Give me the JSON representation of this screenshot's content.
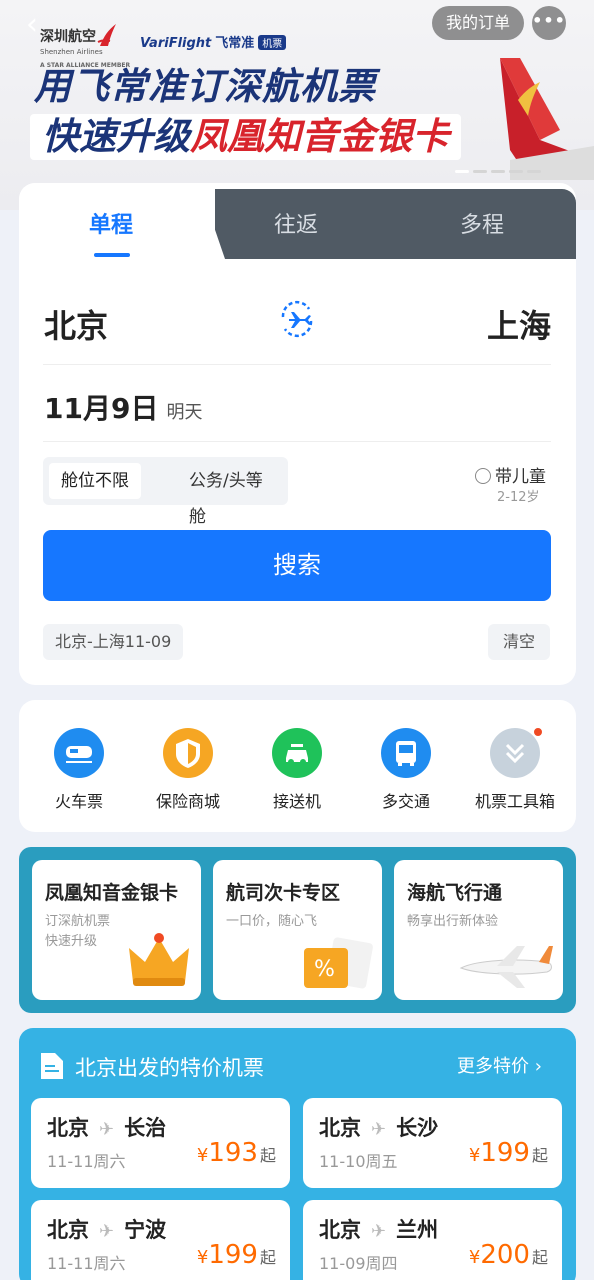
{
  "top": {
    "back_glyph": "‹",
    "orders_label": "我的订单",
    "more_glyph": "•••",
    "brand_cn": "深圳航空",
    "brand_en": "Shenzhen Airlines",
    "alliance": "A STAR ALLIANCE MEMBER",
    "variflight": "VariFlight",
    "variflight_cn": "飞常准",
    "variflight_tag": "机票"
  },
  "banner": {
    "line1": "用飞常准订深航机票",
    "line2_a": "快速升级",
    "line2_b": "凤凰知音金银卡"
  },
  "booking": {
    "tabs": [
      "单程",
      "往返",
      "多程"
    ],
    "from_city": "北京",
    "to_city": "上海",
    "date": "11月9日",
    "date_rel": "明天",
    "cabin_options": [
      "舱位不限",
      "公务/头等舱"
    ],
    "child_label": "带儿童",
    "child_age": "2-12岁",
    "search_label": "搜索",
    "history_item": "北京-上海11-09",
    "clear_label": "清空"
  },
  "services": [
    {
      "label": "火车票",
      "icon": "train-icon",
      "color": "#1f8cf0"
    },
    {
      "label": "保险商城",
      "icon": "shield-icon",
      "color": "#f6a623"
    },
    {
      "label": "接送机",
      "icon": "car-icon",
      "color": "#1fc25a"
    },
    {
      "label": "多交通",
      "icon": "bus-icon",
      "color": "#1f8cf0"
    },
    {
      "label": "机票工具箱",
      "icon": "chevron-double-down-icon",
      "color": "#c7d2dc"
    }
  ],
  "promos": [
    {
      "title": "凤凰知音金银卡",
      "sub1": "订深航机票",
      "sub2": "快速升级"
    },
    {
      "title": "航司次卡专区",
      "sub1": "一口价，随心飞",
      "sub2": ""
    },
    {
      "title": "海航飞行通",
      "sub1": "畅享出行新体验",
      "sub2": ""
    }
  ],
  "deals": {
    "title": "北京出发的特价机票",
    "more": "更多特价",
    "more_arrow": "›",
    "plane_glyph": "✈",
    "currency": "¥",
    "suffix": "起",
    "items": [
      {
        "from": "北京",
        "to": "长治",
        "date": "11-11周六",
        "price": "193"
      },
      {
        "from": "北京",
        "to": "长沙",
        "date": "11-10周五",
        "price": "199"
      },
      {
        "from": "北京",
        "to": "宁波",
        "date": "11-11周六",
        "price": "199"
      },
      {
        "from": "北京",
        "to": "兰州",
        "date": "11-09周四",
        "price": "200"
      }
    ]
  },
  "colors": {
    "accent": "#1677ff",
    "brand_navy": "#1b3478",
    "brand_red": "#d8242c",
    "price": "#ff6a00",
    "deals_bg": "#35b2e4",
    "promo_bg": "#2a9dbf"
  }
}
